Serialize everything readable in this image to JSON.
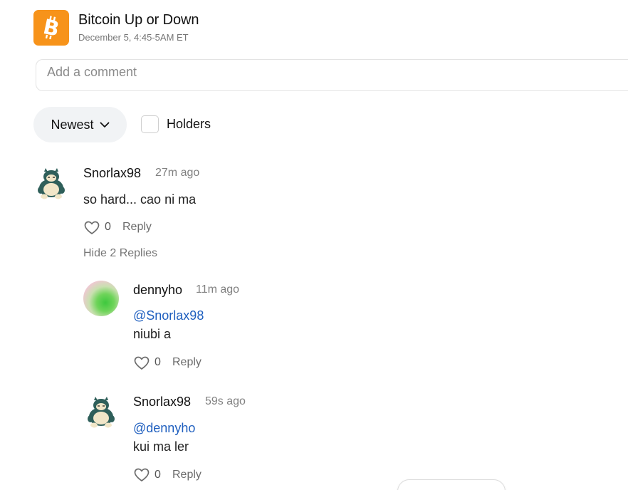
{
  "market": {
    "title": "Bitcoin Up or Down",
    "subtitle": "December 5, 4:45-5AM ET",
    "icon": "bitcoin-icon",
    "brand_color": "#f7931a"
  },
  "comment_box": {
    "placeholder": "Add a comment",
    "value": ""
  },
  "filters": {
    "sort_label": "Newest",
    "holders_label": "Holders",
    "holders_checked": false
  },
  "comments": [
    {
      "username": "Snorlax98",
      "time": "27m ago",
      "text": "so hard... cao ni ma",
      "likes": "0",
      "reply_label": "Reply",
      "toggle_replies": "Hide 2 Replies",
      "avatar": "snorlax-avatar",
      "replies": [
        {
          "username": "dennyho",
          "time": "11m ago",
          "mention": "@Snorlax98",
          "text": "niubi a",
          "likes": "0",
          "reply_label": "Reply",
          "avatar": "gradient-avatar"
        },
        {
          "username": "Snorlax98",
          "time": "59s ago",
          "mention": "@dennyho",
          "text": "kui ma ler",
          "likes": "0",
          "reply_label": "Reply",
          "avatar": "snorlax-avatar"
        }
      ]
    }
  ],
  "colors": {
    "mention": "#1f5fbf",
    "muted": "#808080",
    "pill_bg": "#f1f3f5"
  }
}
